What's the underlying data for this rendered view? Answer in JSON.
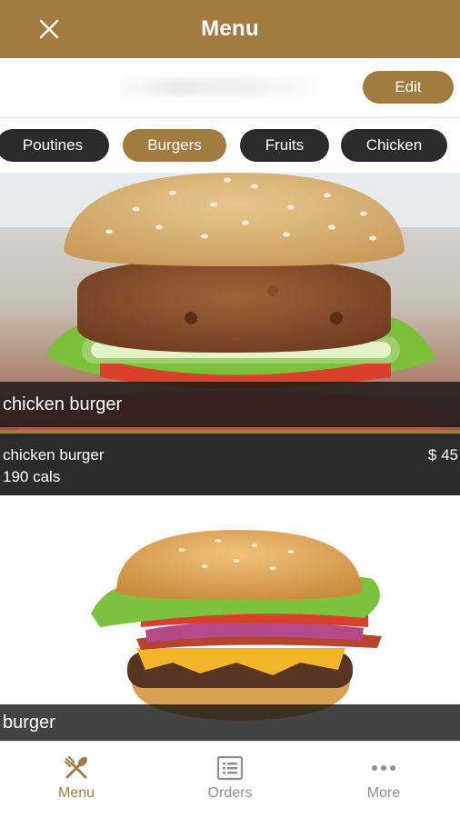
{
  "header": {
    "title": "Menu",
    "close_icon": "close-icon"
  },
  "toolbar": {
    "edit_label": "Edit"
  },
  "categories": [
    {
      "label": "Poutines",
      "active": false
    },
    {
      "label": "Burgers",
      "active": true
    },
    {
      "label": "Fruits",
      "active": false
    },
    {
      "label": "Chicken",
      "active": false
    }
  ],
  "items": [
    {
      "overlay_title": "chicken burger",
      "name": "chicken burger",
      "calories": "190 cals",
      "price": "$ 45"
    },
    {
      "overlay_title": "burger"
    }
  ],
  "tabs": [
    {
      "label": "Menu",
      "icon": "utensils-icon",
      "active": true
    },
    {
      "label": "Orders",
      "icon": "list-icon",
      "active": false
    },
    {
      "label": "More",
      "icon": "more-icon",
      "active": false
    }
  ],
  "colors": {
    "accent": "#a37a40",
    "dark": "#2b2b2b",
    "inactive": "#8f8f8f"
  }
}
